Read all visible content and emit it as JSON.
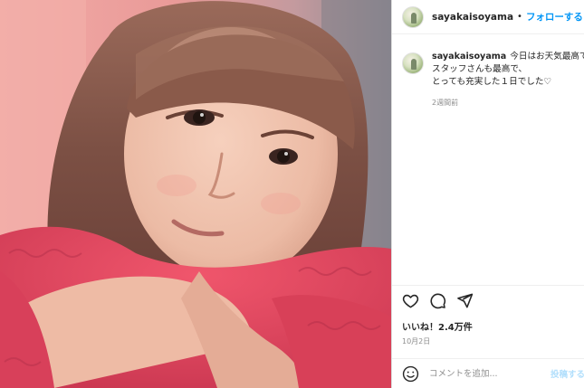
{
  "post": {
    "username": "sayakaisoyama",
    "separator": "•",
    "follow_label": "フォローする",
    "caption": {
      "username": "sayakaisoyama",
      "lines": [
        "今日はお天気最高で、",
        "スタッフさんも最高で、",
        "とっても充実した１日でした♡"
      ]
    },
    "posted_ago": "2週間前",
    "likes": "いいね！2.4万件",
    "date": "10月2日",
    "comment": {
      "placeholder": "コメントを追加...",
      "post_label": "投稿する"
    },
    "icons": {
      "like": "heart-icon",
      "comment": "comment-icon",
      "share": "share-icon",
      "emoji": "emoji-icon"
    },
    "colors": {
      "accent": "#0095f6",
      "post_button_disabled": "#b2dffc",
      "sweater": "#e2475f"
    }
  }
}
